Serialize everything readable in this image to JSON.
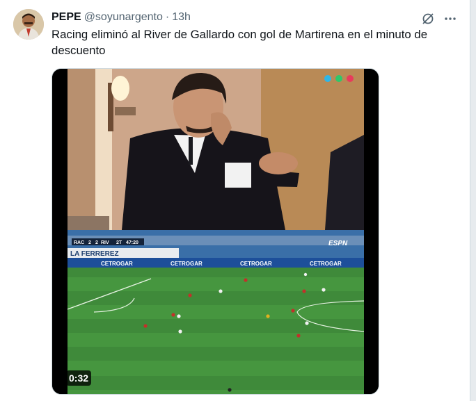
{
  "tweet": {
    "author_name": "PEPE",
    "author_handle": "@soyunargento",
    "separator": "·",
    "time": "13h",
    "text": "Racing eliminó al River de Gallardo con gol de Martirena en el minuto de descuento"
  },
  "video": {
    "duration": "0:32",
    "scoreboard": {
      "home": "RAC",
      "home_score": "2",
      "away_score": "2",
      "away": "RIV",
      "period": "2T",
      "clock": "47:20"
    },
    "network_logo": "ESPN",
    "ad_text": "CETROGAR",
    "banner_text": "LA FERREREZ"
  },
  "colors": {
    "text_primary": "#0f1419",
    "text_secondary": "#536471",
    "pitch_green": "#3f8a3a",
    "stand_blue": "#3a6fa8"
  },
  "icons": {
    "grok": "grok-icon",
    "more": "more-icon"
  }
}
